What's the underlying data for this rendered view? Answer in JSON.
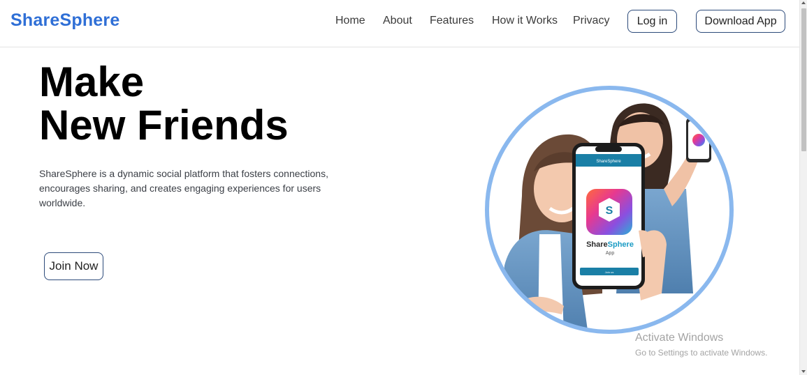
{
  "header": {
    "brand": "ShareSphere",
    "nav": [
      {
        "label": "Home"
      },
      {
        "label": "About"
      },
      {
        "label": "Features"
      },
      {
        "label": "How it Works"
      },
      {
        "label": "Privacy"
      }
    ],
    "login_label": "Log in",
    "download_label": "Download App"
  },
  "hero": {
    "title_line1": "Make",
    "title_line2": "New Friends",
    "description": "ShareSphere is a dynamic social platform that fosters connections, encourages sharing, and creates engaging experiences for users worldwide.",
    "join_label": "Join Now",
    "phone": {
      "app_bar_title": "ShareSphere",
      "logo_letter": "S",
      "app_name_part1": "Share",
      "app_name_part2": "Sphere",
      "app_sub": "App",
      "button_label": "Join us"
    }
  },
  "watermark": {
    "title": "Activate Windows",
    "subtitle": "Go to Settings to activate Windows."
  },
  "colors": {
    "brand": "#2f6fd6",
    "button_border": "#2c4a7a",
    "circle_ring": "#8ab8ee",
    "app_teal": "#1a7fa6"
  }
}
